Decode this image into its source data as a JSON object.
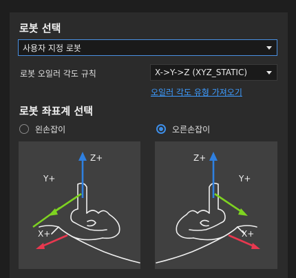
{
  "robot_select": {
    "title": "로봇 선택",
    "dropdown_value": "사용자 지정 로봇"
  },
  "euler": {
    "label": "로봇 오일러 각도 규칙",
    "dropdown_value": "X->Y->Z (XYZ_STATIC)",
    "link": "오일러 각도 유형 가져오기"
  },
  "coordinate": {
    "title": "로봇 좌표계 선택",
    "left_hand": {
      "label": "왼손잡이",
      "selected": false
    },
    "right_hand": {
      "label": "오른손잡이",
      "selected": true
    }
  },
  "axes": {
    "z": "Z+",
    "y": "Y+",
    "x": "X+"
  },
  "colors": {
    "accent": "#3d8ee8",
    "link": "#3d9bff",
    "z_axis": "#2f80e0",
    "y_axis": "#7ed321",
    "x_axis": "#e8384f"
  }
}
